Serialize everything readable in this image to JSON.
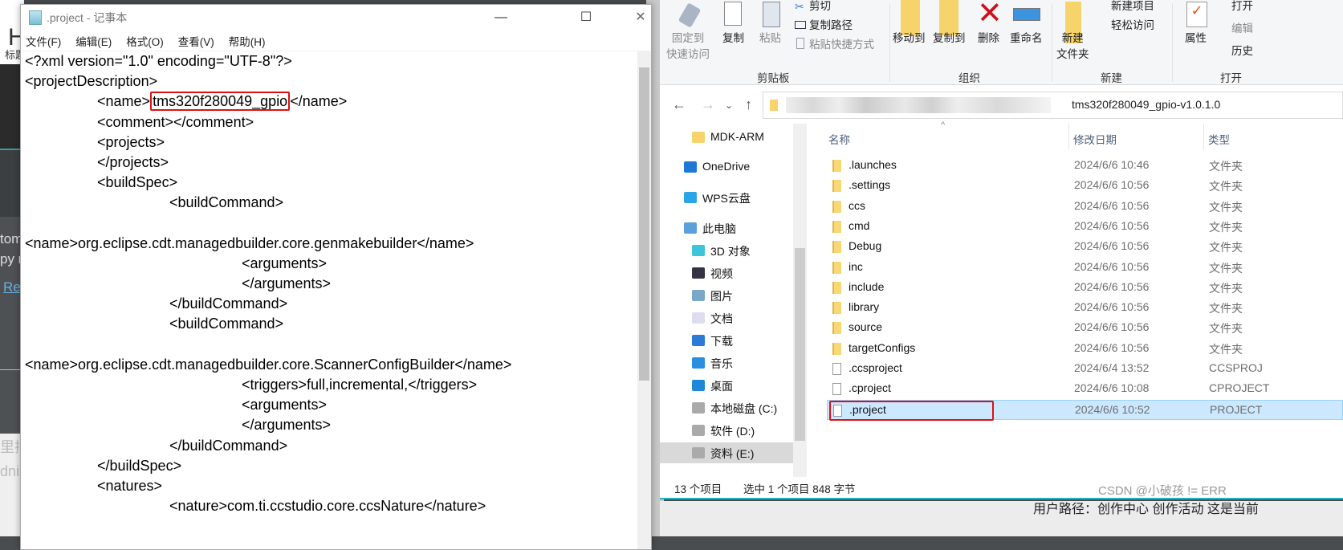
{
  "background": {
    "left_fragments": [
      "tom",
      "py r",
      "Res"
    ],
    "left_light_fragments": [
      "里插",
      "dni"
    ],
    "top_fragments": [
      "H",
      "标题"
    ],
    "bottom_text": "用户路径：创作中心    创作活动    这是当前"
  },
  "notepad": {
    "title": ".project - 记事本",
    "window_buttons": {
      "minimize": "—",
      "maximize": "☐",
      "close": "✕"
    },
    "menu": [
      "文件(F)",
      "编辑(E)",
      "格式(O)",
      "查看(V)",
      "帮助(H)"
    ],
    "lines": [
      {
        "indent": 0,
        "text": "<?xml version=\"1.0\" encoding=\"UTF-8\"?>"
      },
      {
        "indent": 0,
        "text": "<projectDescription>"
      },
      {
        "indent": 1,
        "pre": "<name>",
        "highlight": "tms320f280049_gpio",
        "post": "</name>"
      },
      {
        "indent": 1,
        "text": "<comment></comment>"
      },
      {
        "indent": 1,
        "text": "<projects>"
      },
      {
        "indent": 1,
        "text": "</projects>"
      },
      {
        "indent": 1,
        "text": "<buildSpec>"
      },
      {
        "indent": 2,
        "text": "<buildCommand>"
      },
      {
        "indent": 0,
        "text": ""
      },
      {
        "indent": 0,
        "text": "<name>org.eclipse.cdt.managedbuilder.core.genmakebuilder</name>"
      },
      {
        "indent": 3,
        "text": "<arguments>"
      },
      {
        "indent": 3,
        "text": "</arguments>"
      },
      {
        "indent": 2,
        "text": "</buildCommand>"
      },
      {
        "indent": 2,
        "text": "<buildCommand>"
      },
      {
        "indent": 0,
        "text": ""
      },
      {
        "indent": 0,
        "text": "<name>org.eclipse.cdt.managedbuilder.core.ScannerConfigBuilder</name>"
      },
      {
        "indent": 3,
        "text": "<triggers>full,incremental,</triggers>"
      },
      {
        "indent": 3,
        "text": "<arguments>"
      },
      {
        "indent": 3,
        "text": "</arguments>"
      },
      {
        "indent": 2,
        "text": "</buildCommand>"
      },
      {
        "indent": 1,
        "text": "</buildSpec>"
      },
      {
        "indent": 1,
        "text": "<natures>"
      },
      {
        "indent": 2,
        "text": "<nature>com.ti.ccstudio.core.ccsNature</nature>"
      }
    ],
    "highlight_color": "#e01010"
  },
  "explorer": {
    "ribbon": {
      "pin": "固定到\n快速访问",
      "copy": "复制",
      "paste": "粘贴",
      "cut": "剪切",
      "copy_path": "复制路径",
      "paste_shortcut": "粘贴快捷方式",
      "move_to": "移动到",
      "copy_to": "复制到",
      "delete": "删除",
      "rename": "重命名",
      "new_folder": "新建\n文件夹",
      "new_item": "新建项目",
      "easy_access": "轻松访问",
      "properties": "属性",
      "open": "打开",
      "edit": "编辑",
      "history": "历史",
      "groups": [
        "剪贴板",
        "组织",
        "新建",
        "打开"
      ]
    },
    "address": {
      "path_tail": "tms320f280049_gpio-v1.0.1.0"
    },
    "nav": [
      {
        "label": "MDK-ARM",
        "icon": "folder-icon",
        "level": 1
      },
      {
        "label": "OneDrive",
        "icon": "cloud-icon",
        "level": 0
      },
      {
        "label": "WPS云盘",
        "icon": "wps-cloud-icon",
        "level": 0
      },
      {
        "label": "此电脑",
        "icon": "computer-icon",
        "level": 0
      },
      {
        "label": "3D 对象",
        "icon": "cube-icon",
        "level": 1
      },
      {
        "label": "视频",
        "icon": "video-icon",
        "level": 1
      },
      {
        "label": "图片",
        "icon": "picture-icon",
        "level": 1
      },
      {
        "label": "文档",
        "icon": "document-icon",
        "level": 1
      },
      {
        "label": "下载",
        "icon": "download-icon",
        "level": 1
      },
      {
        "label": "音乐",
        "icon": "music-icon",
        "level": 1
      },
      {
        "label": "桌面",
        "icon": "desktop-icon",
        "level": 1
      },
      {
        "label": "本地磁盘 (C:)",
        "icon": "drive-icon",
        "level": 1
      },
      {
        "label": "软件 (D:)",
        "icon": "drive-icon",
        "level": 1
      },
      {
        "label": "资料 (E:)",
        "icon": "drive-icon",
        "level": 1,
        "selected": true
      }
    ],
    "columns": {
      "name": "名称",
      "date": "修改日期",
      "type": "类型"
    },
    "files": [
      {
        "name": ".launches",
        "date": "2024/6/6 10:46",
        "type": "文件夹",
        "kind": "folder"
      },
      {
        "name": ".settings",
        "date": "2024/6/6 10:56",
        "type": "文件夹",
        "kind": "folder"
      },
      {
        "name": "ccs",
        "date": "2024/6/6 10:56",
        "type": "文件夹",
        "kind": "folder"
      },
      {
        "name": "cmd",
        "date": "2024/6/6 10:56",
        "type": "文件夹",
        "kind": "folder"
      },
      {
        "name": "Debug",
        "date": "2024/6/6 10:56",
        "type": "文件夹",
        "kind": "folder"
      },
      {
        "name": "inc",
        "date": "2024/6/6 10:56",
        "type": "文件夹",
        "kind": "folder"
      },
      {
        "name": "include",
        "date": "2024/6/6 10:56",
        "type": "文件夹",
        "kind": "folder"
      },
      {
        "name": "library",
        "date": "2024/6/6 10:56",
        "type": "文件夹",
        "kind": "folder"
      },
      {
        "name": "source",
        "date": "2024/6/6 10:56",
        "type": "文件夹",
        "kind": "folder"
      },
      {
        "name": "targetConfigs",
        "date": "2024/6/6 10:56",
        "type": "文件夹",
        "kind": "folder"
      },
      {
        "name": ".ccsproject",
        "date": "2024/6/4 13:52",
        "type": "CCSPROJ",
        "kind": "file"
      },
      {
        "name": ".cproject",
        "date": "2024/6/6 10:08",
        "type": "CPROJECT",
        "kind": "file"
      },
      {
        "name": ".project",
        "date": "2024/6/6 10:52",
        "type": "PROJECT",
        "kind": "file",
        "selected": true
      }
    ],
    "status": {
      "count": "13 个项目",
      "selected": "选中 1 个项目  848 字节"
    },
    "watermark": "CSDN @小破孩 != ERR"
  }
}
